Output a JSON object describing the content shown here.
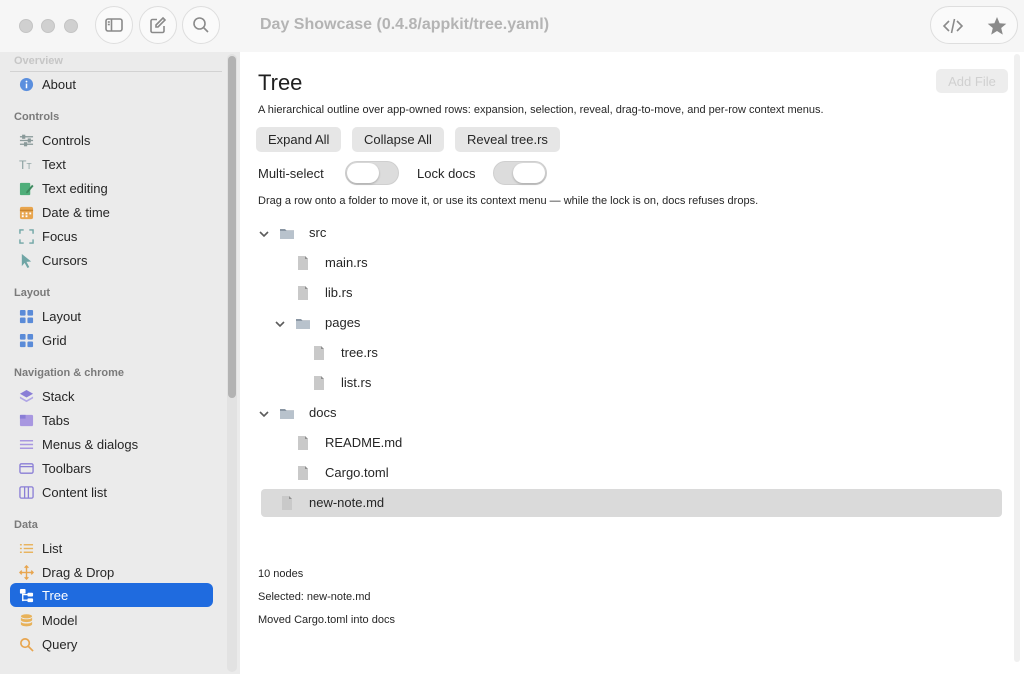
{
  "window": {
    "title": "Day Showcase (0.4.8/appkit/tree.yaml)"
  },
  "sidebar": {
    "faded_section": "Overview",
    "sections": [
      {
        "label": "Controls"
      },
      {
        "label": "Layout"
      },
      {
        "label": "Navigation & chrome"
      },
      {
        "label": "Data"
      }
    ],
    "items": [
      {
        "label": "About",
        "icon": "info-icon"
      },
      {
        "label": "Controls",
        "icon": "sliders-icon"
      },
      {
        "label": "Text",
        "icon": "text-icon"
      },
      {
        "label": "Text editing",
        "icon": "edit-icon"
      },
      {
        "label": "Date & time",
        "icon": "calendar-icon"
      },
      {
        "label": "Focus",
        "icon": "focus-icon"
      },
      {
        "label": "Cursors",
        "icon": "cursor-icon"
      },
      {
        "label": "Layout",
        "icon": "layout-icon"
      },
      {
        "label": "Grid",
        "icon": "grid-icon"
      },
      {
        "label": "Stack",
        "icon": "stack-icon"
      },
      {
        "label": "Tabs",
        "icon": "tabs-icon"
      },
      {
        "label": "Menus & dialogs",
        "icon": "menu-icon"
      },
      {
        "label": "Toolbars",
        "icon": "toolbar-icon"
      },
      {
        "label": "Content list",
        "icon": "columns-icon"
      },
      {
        "label": "List",
        "icon": "list-icon"
      },
      {
        "label": "Drag & Drop",
        "icon": "move-icon"
      },
      {
        "label": "Tree",
        "icon": "tree-icon",
        "selected": true
      },
      {
        "label": "Model",
        "icon": "database-icon"
      },
      {
        "label": "Query",
        "icon": "search-icon"
      }
    ]
  },
  "main": {
    "title": "Tree",
    "add_file_label": "Add File",
    "description": "A hierarchical outline over app-owned rows: expansion, selection, reveal, drag-to-move, and per-row context menus.",
    "buttons": {
      "expand_all": "Expand All",
      "collapse_all": "Collapse All",
      "reveal": "Reveal tree.rs"
    },
    "toggles": {
      "multi_select_label": "Multi-select",
      "multi_select_on": false,
      "lock_docs_label": "Lock docs",
      "lock_docs_on": false
    },
    "hint": "Drag a row onto a folder to move it, or use its context menu — while the lock is on, docs refuses drops.",
    "tree": [
      {
        "label": "src",
        "type": "folder",
        "expanded": true,
        "depth": 0
      },
      {
        "label": "main.rs",
        "type": "file",
        "depth": 1
      },
      {
        "label": "lib.rs",
        "type": "file",
        "depth": 1
      },
      {
        "label": "pages",
        "type": "folder",
        "expanded": true,
        "depth": 1
      },
      {
        "label": "tree.rs",
        "type": "file",
        "depth": 2
      },
      {
        "label": "list.rs",
        "type": "file",
        "depth": 2
      },
      {
        "label": "docs",
        "type": "folder",
        "expanded": true,
        "depth": 0
      },
      {
        "label": "README.md",
        "type": "file",
        "depth": 1
      },
      {
        "label": "Cargo.toml",
        "type": "file",
        "depth": 1
      },
      {
        "label": "new-note.md",
        "type": "file",
        "depth": 0,
        "selected": true
      }
    ],
    "status": {
      "node_count": "10 nodes",
      "selected": "Selected: new-note.md",
      "last_action": "Moved Cargo.toml into docs"
    }
  },
  "colors": {
    "accent": "#1f6bdf",
    "sidebar_bg": "#ebebeb",
    "selection_row": "#dadada"
  }
}
